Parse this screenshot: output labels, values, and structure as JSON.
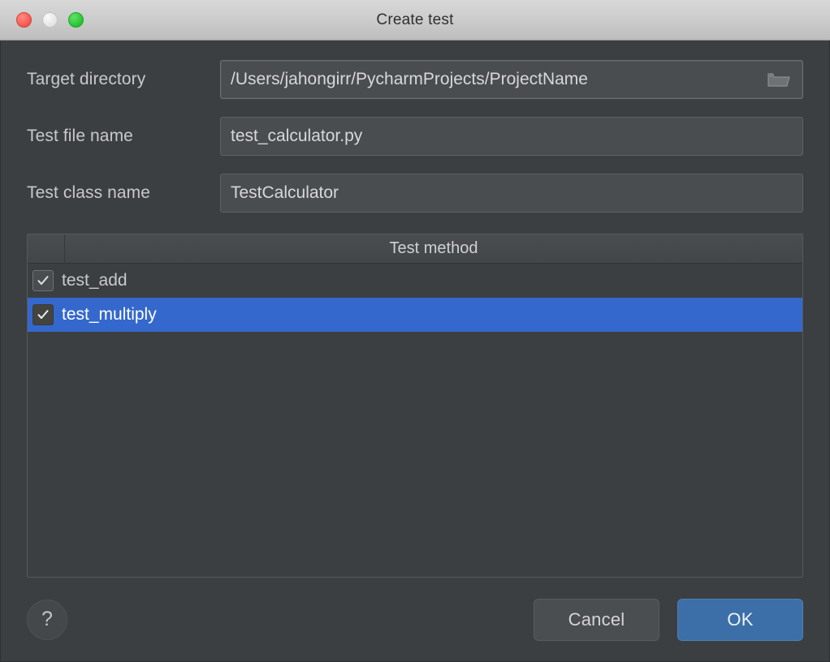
{
  "window": {
    "title": "Create test",
    "controls": {
      "close": "close-button",
      "minimize": "minimize-button",
      "maximize": "maximize-button"
    }
  },
  "form": {
    "target_directory": {
      "label": "Target directory",
      "value": "/Users/jahongirr/PycharmProjects/ProjectName",
      "browse_icon": "folder-open-icon"
    },
    "test_file_name": {
      "label": "Test file name",
      "value": "test_calculator.py"
    },
    "test_class_name": {
      "label": "Test class name",
      "value": "TestCalculator"
    }
  },
  "table": {
    "columns": [
      "",
      "Test method"
    ],
    "rows": [
      {
        "label": "test_add",
        "checked": true,
        "selected": false
      },
      {
        "label": "test_multiply",
        "checked": true,
        "selected": true
      }
    ]
  },
  "footer": {
    "help_label": "?",
    "cancel_label": "Cancel",
    "ok_label": "OK"
  },
  "colors": {
    "dialog_background": "#3c3f41",
    "field_background": "#4a4d4f",
    "selection_blue": "#3468cc",
    "ok_button_blue": "#3c6fa8",
    "titlebar_gray": "#cccccc",
    "text_primary": "#c8cacb"
  }
}
